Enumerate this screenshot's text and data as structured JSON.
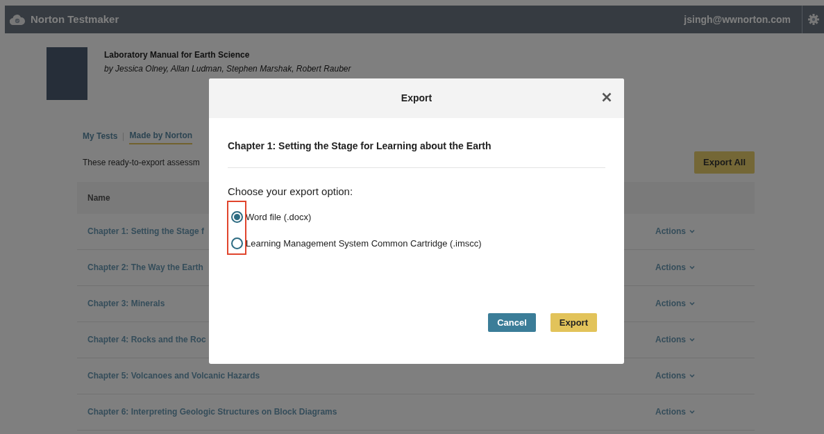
{
  "app": {
    "title": "Norton Testmaker",
    "user": "jsingh@wwnorton.com"
  },
  "book": {
    "title": "Laboratory Manual for Earth Science",
    "authors": "by Jessica Olney, Allan Ludman, Stephen Marshak, Robert Rauber"
  },
  "tabs": [
    {
      "label": "My Tests",
      "selected": false
    },
    {
      "label": "Made by Norton",
      "selected": true
    }
  ],
  "description": "These ready-to-export assessm",
  "export_all": "Export All",
  "table": {
    "columns": [
      "Name"
    ],
    "rows": [
      {
        "name": "Chapter 1: Setting the Stage f",
        "action": "Actions"
      },
      {
        "name": "Chapter 2: The Way the Earth",
        "action": "Actions"
      },
      {
        "name": "Chapter 3: Minerals",
        "action": "Actions"
      },
      {
        "name": "Chapter 4: Rocks and the Roc",
        "action": "Actions"
      },
      {
        "name": "Chapter 5: Volcanoes and Volcanic Hazards",
        "action": "Actions"
      },
      {
        "name": "Chapter 6: Interpreting Geologic Structures on Block Diagrams",
        "action": "Actions"
      }
    ]
  },
  "modal": {
    "title": "Export",
    "heading": "Chapter 1: Setting the Stage for Learning about the Earth",
    "prompt": "Choose your export option:",
    "options": [
      {
        "label": "Word file (.docx)",
        "selected": true
      },
      {
        "label": "Learning Management System Common Cartridge (.imscc)",
        "selected": false
      }
    ],
    "buttons": [
      {
        "label": "Cancel",
        "kind": "secondary"
      },
      {
        "label": "Export",
        "kind": "primary"
      }
    ]
  }
}
